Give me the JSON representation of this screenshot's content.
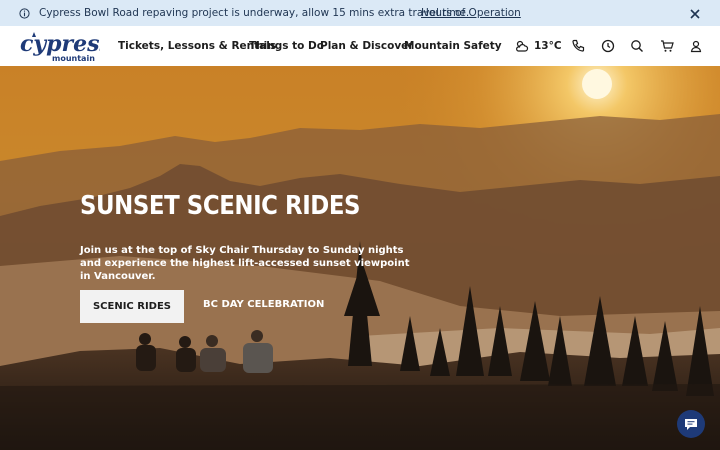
{
  "banner": {
    "message": "Cypress Bowl Road repaving project is underway, allow 15 mins extra travel time.",
    "link_label": "Hours of Operation"
  },
  "header": {
    "logo_text_main": "cypress",
    "logo_text_sub": "mountain",
    "nav": [
      {
        "label": "Tickets, Lessons & Rentals"
      },
      {
        "label": "Things to Do"
      },
      {
        "label": "Plan & Discover"
      },
      {
        "label": "Mountain Safety"
      }
    ],
    "weather": {
      "temperature": "13°C",
      "icon": "partly-cloudy-icon"
    },
    "icons": [
      "phone-icon",
      "clock-icon",
      "search-icon",
      "cart-icon",
      "user-icon"
    ]
  },
  "hero": {
    "title": "SUNSET SCENIC RIDES",
    "subtitle": "Join us at the top of Sky Chair Thursday to Sunday nights and experience the highest lift-accessed sunset viewpoint in Vancouver.",
    "primary_button": "SCENIC RIDES",
    "secondary_button": "BC DAY CELEBRATION"
  },
  "colors": {
    "banner_bg": "#dbe9f6",
    "brand_blue": "#1e3a78",
    "sky_top": "#d08a2a",
    "sun": "#fff4c8"
  }
}
